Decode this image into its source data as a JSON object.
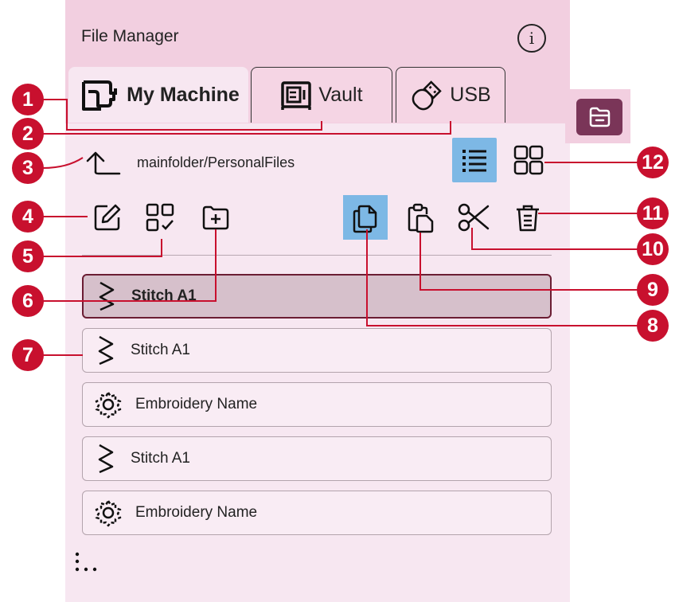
{
  "header": {
    "title": "File Manager"
  },
  "tabs": [
    {
      "label": "My Machine",
      "icon": "sewing-machine-icon",
      "active": true
    },
    {
      "label": "Vault",
      "icon": "vault-icon",
      "active": false
    },
    {
      "label": "USB",
      "icon": "usb-icon",
      "active": false
    }
  ],
  "path": {
    "text": "mainfolder/PersonalFiles"
  },
  "view_modes": {
    "selected": "list"
  },
  "toolbar": {
    "selected": "copy"
  },
  "files": [
    {
      "name": "Stitch A1",
      "icon": "stitch-icon",
      "selected": true
    },
    {
      "name": "Stitch A1",
      "icon": "stitch-icon",
      "selected": false
    },
    {
      "name": "Embroidery Name",
      "icon": "embroidery-icon",
      "selected": false
    },
    {
      "name": "Stitch A1",
      "icon": "stitch-icon",
      "selected": false
    },
    {
      "name": "Embroidery Name",
      "icon": "embroidery-icon",
      "selected": false
    }
  ],
  "callouts": [
    "1",
    "2",
    "3",
    "4",
    "5",
    "6",
    "7",
    "8",
    "9",
    "10",
    "11",
    "12"
  ],
  "colors": {
    "accent": "#7db8e5",
    "panel": "#f7e7f1",
    "header": "#f2cfe0",
    "callout": "#c8102e",
    "folder_button": "#7a3558",
    "selected_row": "#d6c0cb"
  }
}
